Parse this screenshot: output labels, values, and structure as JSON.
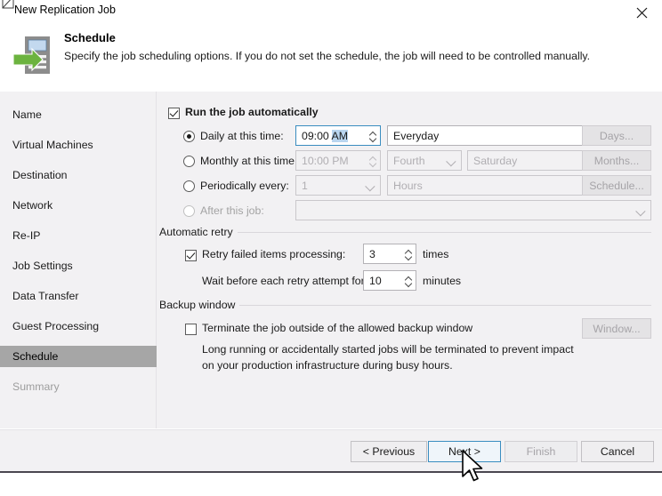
{
  "window": {
    "title": "New Replication Job",
    "close_label": "close-icon",
    "icon": "replication-job-icon"
  },
  "header": {
    "title": "Schedule",
    "subtitle": "Specify the job scheduling options. If you do not set the schedule, the job will need to be controlled manually.",
    "icon": "schedule-server-arrow-icon"
  },
  "sidebar": {
    "items": [
      {
        "label": "Name",
        "state": "normal"
      },
      {
        "label": "Virtual Machines",
        "state": "normal"
      },
      {
        "label": "Destination",
        "state": "normal"
      },
      {
        "label": "Network",
        "state": "normal"
      },
      {
        "label": "Re-IP",
        "state": "normal"
      },
      {
        "label": "Job Settings",
        "state": "normal"
      },
      {
        "label": "Data Transfer",
        "state": "normal"
      },
      {
        "label": "Guest Processing",
        "state": "normal"
      },
      {
        "label": "Schedule",
        "state": "active"
      },
      {
        "label": "Summary",
        "state": "disabled"
      }
    ]
  },
  "main": {
    "run_automatically": {
      "label": "Run the job automatically",
      "checked": true
    },
    "daily": {
      "label": "Daily at this time:",
      "selected": true,
      "time_prefix": "09:00 ",
      "time_suffix": "AM",
      "dropdown_value": "Everyday",
      "button_label": "Days..."
    },
    "monthly": {
      "label": "Monthly at this time:",
      "selected": false,
      "time_value": "10:00 PM",
      "ordinal_value": "Fourth",
      "weekday_value": "Saturday",
      "button_label": "Months..."
    },
    "periodically": {
      "label": "Periodically every:",
      "selected": false,
      "count_value": "1",
      "unit_value": "Hours",
      "button_label": "Schedule..."
    },
    "after_job": {
      "label": "After this job:",
      "selected": false,
      "dropdown_value": ""
    },
    "automatic_retry": {
      "group_label": "Automatic retry",
      "retry_checkbox_label": "Retry failed items processing:",
      "retry_checked": true,
      "retry_times_value": "3",
      "retry_times_suffix": "times",
      "wait_label": "Wait before each retry attempt for:",
      "wait_value": "10",
      "wait_suffix": "minutes"
    },
    "backup_window": {
      "group_label": "Backup window",
      "terminate_label": "Terminate the job outside of the allowed backup window",
      "terminate_checked": false,
      "window_button_label": "Window...",
      "hint_line1": "Long running or accidentally started jobs will be terminated to prevent impact",
      "hint_line2": "on your production infrastructure during busy hours."
    }
  },
  "footer": {
    "previous_label": "< Previous",
    "next_label": "Next >",
    "finish_label": "Finish",
    "cancel_label": "Cancel"
  },
  "colors": {
    "accent": "#3a8dc0",
    "sidebar_active": "#a6a6a6",
    "body_bg": "#f2f1f3",
    "selection": "#b9d5ef",
    "icon_green": "#6cb33f"
  }
}
